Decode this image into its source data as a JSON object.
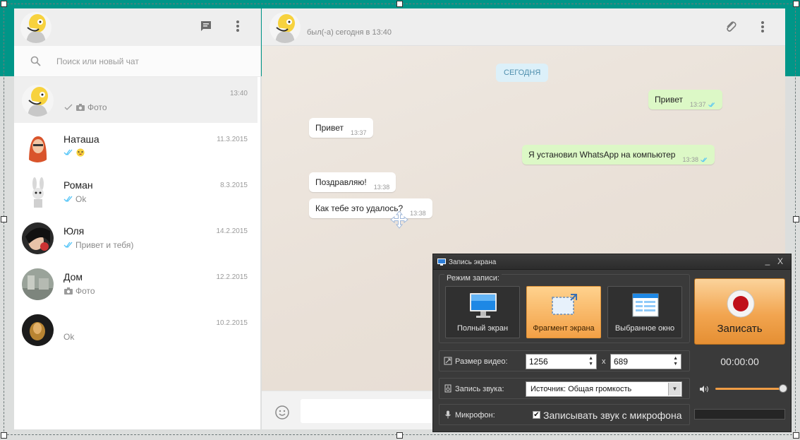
{
  "search": {
    "placeholder": "Поиск или новый чат"
  },
  "chats": [
    {
      "name": "",
      "time": "13:40",
      "preview": "Фото"
    },
    {
      "name": "Наташа",
      "time": "11.3.2015",
      "preview": ""
    },
    {
      "name": "Роман",
      "time": "8.3.2015",
      "preview": "Ok"
    },
    {
      "name": "Юля",
      "time": "14.2.2015",
      "preview": "Привет и тебя)"
    },
    {
      "name": "Дом",
      "time": "12.2.2015",
      "preview": "Фото"
    },
    {
      "name": "",
      "time": "10.2.2015",
      "preview": "Ok"
    }
  ],
  "conversation": {
    "status": "был(-а) сегодня в 13:40",
    "date_chip": "СЕГОДНЯ",
    "messages": [
      {
        "text": "Привет",
        "time": "13:37",
        "dir": "out"
      },
      {
        "text": "Привет",
        "time": "13:37",
        "dir": "in"
      },
      {
        "text": "Я установил WhatsApp на компьютер",
        "time": "13:38",
        "dir": "out"
      },
      {
        "text": "Поздравляю!",
        "time": "13:38",
        "dir": "in"
      },
      {
        "text": "Как тебе это удалось?",
        "time": "13:38",
        "dir": "in"
      }
    ]
  },
  "recorder": {
    "title": "Запись экрана",
    "minimize": "_",
    "close": "X",
    "mode_label": "Режим записи:",
    "modes": [
      "Полный экран",
      "Фрагмент экрана",
      "Выбранное окно"
    ],
    "record_label": "Записать",
    "size_label": "Размер видео:",
    "width": "1256",
    "height": "689",
    "times": "x",
    "audio_label": "Запись звука:",
    "audio_source": "Источник: Общая громкость",
    "mic_label": "Микрофон:",
    "mic_option": "Записывать звук с микрофона",
    "mic_checked": true,
    "timer": "00:00:00",
    "volume_level": 0.95
  },
  "colors": {
    "teal": "#009688",
    "accent_orange": "#f2a046",
    "bubble_out": "#dcf8c6",
    "date_chip": "#dcf0f9"
  }
}
